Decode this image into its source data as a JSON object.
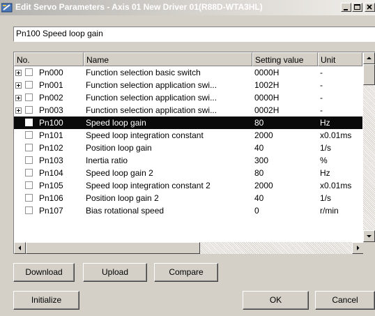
{
  "window": {
    "title": "Edit Servo Parameters - Axis 01 New Driver 01(R88D-WTA3HL)",
    "icon": "edit-parameters-icon"
  },
  "caption_buttons": [
    "minimize-icon",
    "maximize-icon",
    "close-icon"
  ],
  "description": "Pn100 Speed loop gain",
  "table": {
    "columns": [
      "No.",
      "Name",
      "Setting value",
      "Unit"
    ],
    "selected_row": 4,
    "rows": [
      {
        "expandable": true,
        "no": "Pn000",
        "name": "Function selection basic switch",
        "value": "0000H",
        "unit": "-"
      },
      {
        "expandable": true,
        "no": "Pn001",
        "name": "Function selection application swi...",
        "value": "1002H",
        "unit": "-"
      },
      {
        "expandable": true,
        "no": "Pn002",
        "name": "Function selection application swi...",
        "value": "0000H",
        "unit": "-"
      },
      {
        "expandable": true,
        "no": "Pn003",
        "name": "Function selection application swi...",
        "value": "0002H",
        "unit": "-"
      },
      {
        "expandable": false,
        "no": "Pn100",
        "name": "Speed loop gain",
        "value": "80",
        "unit": "Hz"
      },
      {
        "expandable": false,
        "no": "Pn101",
        "name": "Speed loop integration constant",
        "value": "2000",
        "unit": "x0.01ms"
      },
      {
        "expandable": false,
        "no": "Pn102",
        "name": "Position loop gain",
        "value": "40",
        "unit": "1/s"
      },
      {
        "expandable": false,
        "no": "Pn103",
        "name": "Inertia ratio",
        "value": "300",
        "unit": "%"
      },
      {
        "expandable": false,
        "no": "Pn104",
        "name": "Speed loop gain 2",
        "value": "80",
        "unit": "Hz"
      },
      {
        "expandable": false,
        "no": "Pn105",
        "name": "Speed loop integration constant 2",
        "value": "2000",
        "unit": "x0.01ms"
      },
      {
        "expandable": false,
        "no": "Pn106",
        "name": "Position loop gain 2",
        "value": "40",
        "unit": "1/s"
      },
      {
        "expandable": false,
        "no": "Pn107",
        "name": "Bias rotational speed",
        "value": "0",
        "unit": "r/min"
      }
    ]
  },
  "buttons": {
    "download": "Download",
    "upload": "Upload",
    "compare": "Compare",
    "initialize": "Initialize",
    "ok": "OK",
    "cancel": "Cancel"
  },
  "colors": {
    "selection": "#0a0a0a",
    "face": "#d4d0c8"
  }
}
